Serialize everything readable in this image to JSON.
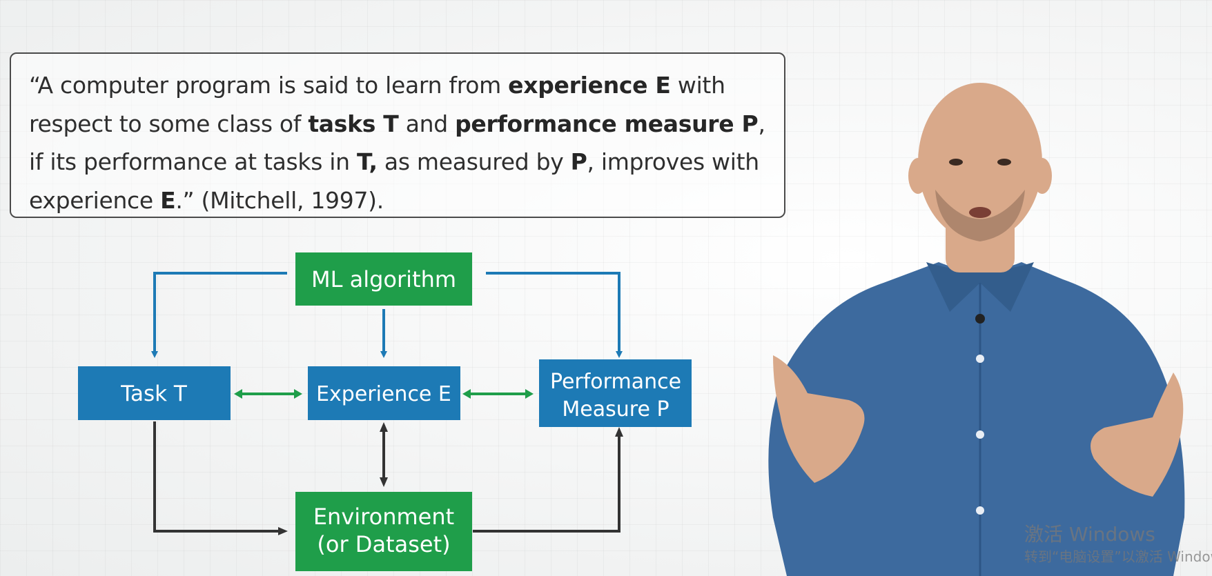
{
  "quote": {
    "segments": [
      {
        "text": "“A computer program is said to learn from ",
        "bold": false
      },
      {
        "text": "experience E",
        "bold": true
      },
      {
        "text": " with respect to some class of ",
        "bold": false
      },
      {
        "text": "tasks T",
        "bold": true
      },
      {
        "text": " and ",
        "bold": false
      },
      {
        "text": "performance measure P",
        "bold": true
      },
      {
        "text": ", if its performance at tasks in ",
        "bold": false
      },
      {
        "text": "T,",
        "bold": true
      },
      {
        "text": " as measured by ",
        "bold": false
      },
      {
        "text": "P",
        "bold": true
      },
      {
        "text": ", improves with experience ",
        "bold": false
      },
      {
        "text": "E",
        "bold": true
      },
      {
        "text": ".” (Mitchell, 1997).",
        "bold": false
      }
    ]
  },
  "diagram": {
    "nodes": {
      "ml_algorithm": {
        "lines": [
          "ML algorithm"
        ],
        "color": "#1f9e4a"
      },
      "task": {
        "lines": [
          "Task T"
        ],
        "color": "#1d7ab5"
      },
      "experience": {
        "lines": [
          "Experience E"
        ],
        "color": "#1d7ab5"
      },
      "performance": {
        "lines": [
          "Performance",
          "Measure P"
        ],
        "color": "#1d7ab5"
      },
      "environment": {
        "lines": [
          "Environment",
          "(or Dataset)"
        ],
        "color": "#1f9e4a"
      }
    },
    "edge_colors": {
      "blue": "#1d7ab5",
      "green": "#1f9e4a",
      "dark": "#333333"
    }
  },
  "watermark": {
    "line1": "激活 Windows",
    "line2": "转到“电脑设置”以激活 Windows"
  },
  "colors": {
    "shirt": "#3d6a9e",
    "skin": "#d9a98a"
  }
}
